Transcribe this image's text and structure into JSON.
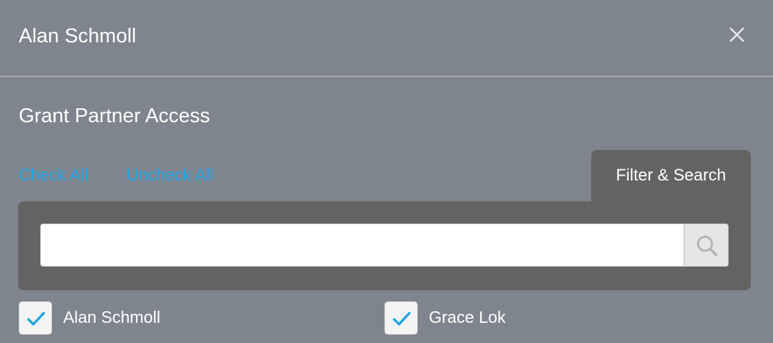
{
  "header": {
    "title": "Alan Schmoll",
    "close_icon": "close-icon"
  },
  "section": {
    "title": "Grant Partner Access"
  },
  "actions": {
    "check_all": "Check All",
    "uncheck_all": "Uncheck All"
  },
  "filter": {
    "tab_label": "Filter & Search",
    "search_value": "",
    "search_placeholder": "",
    "search_icon": "search-icon"
  },
  "partners": [
    {
      "label": "Alan Schmoll",
      "checked": true
    },
    {
      "label": "Grace Lok",
      "checked": true
    }
  ],
  "colors": {
    "background": "#7f858e",
    "panel": "#636363",
    "link": "#1fa4e6",
    "check": "#1fa4e6"
  }
}
